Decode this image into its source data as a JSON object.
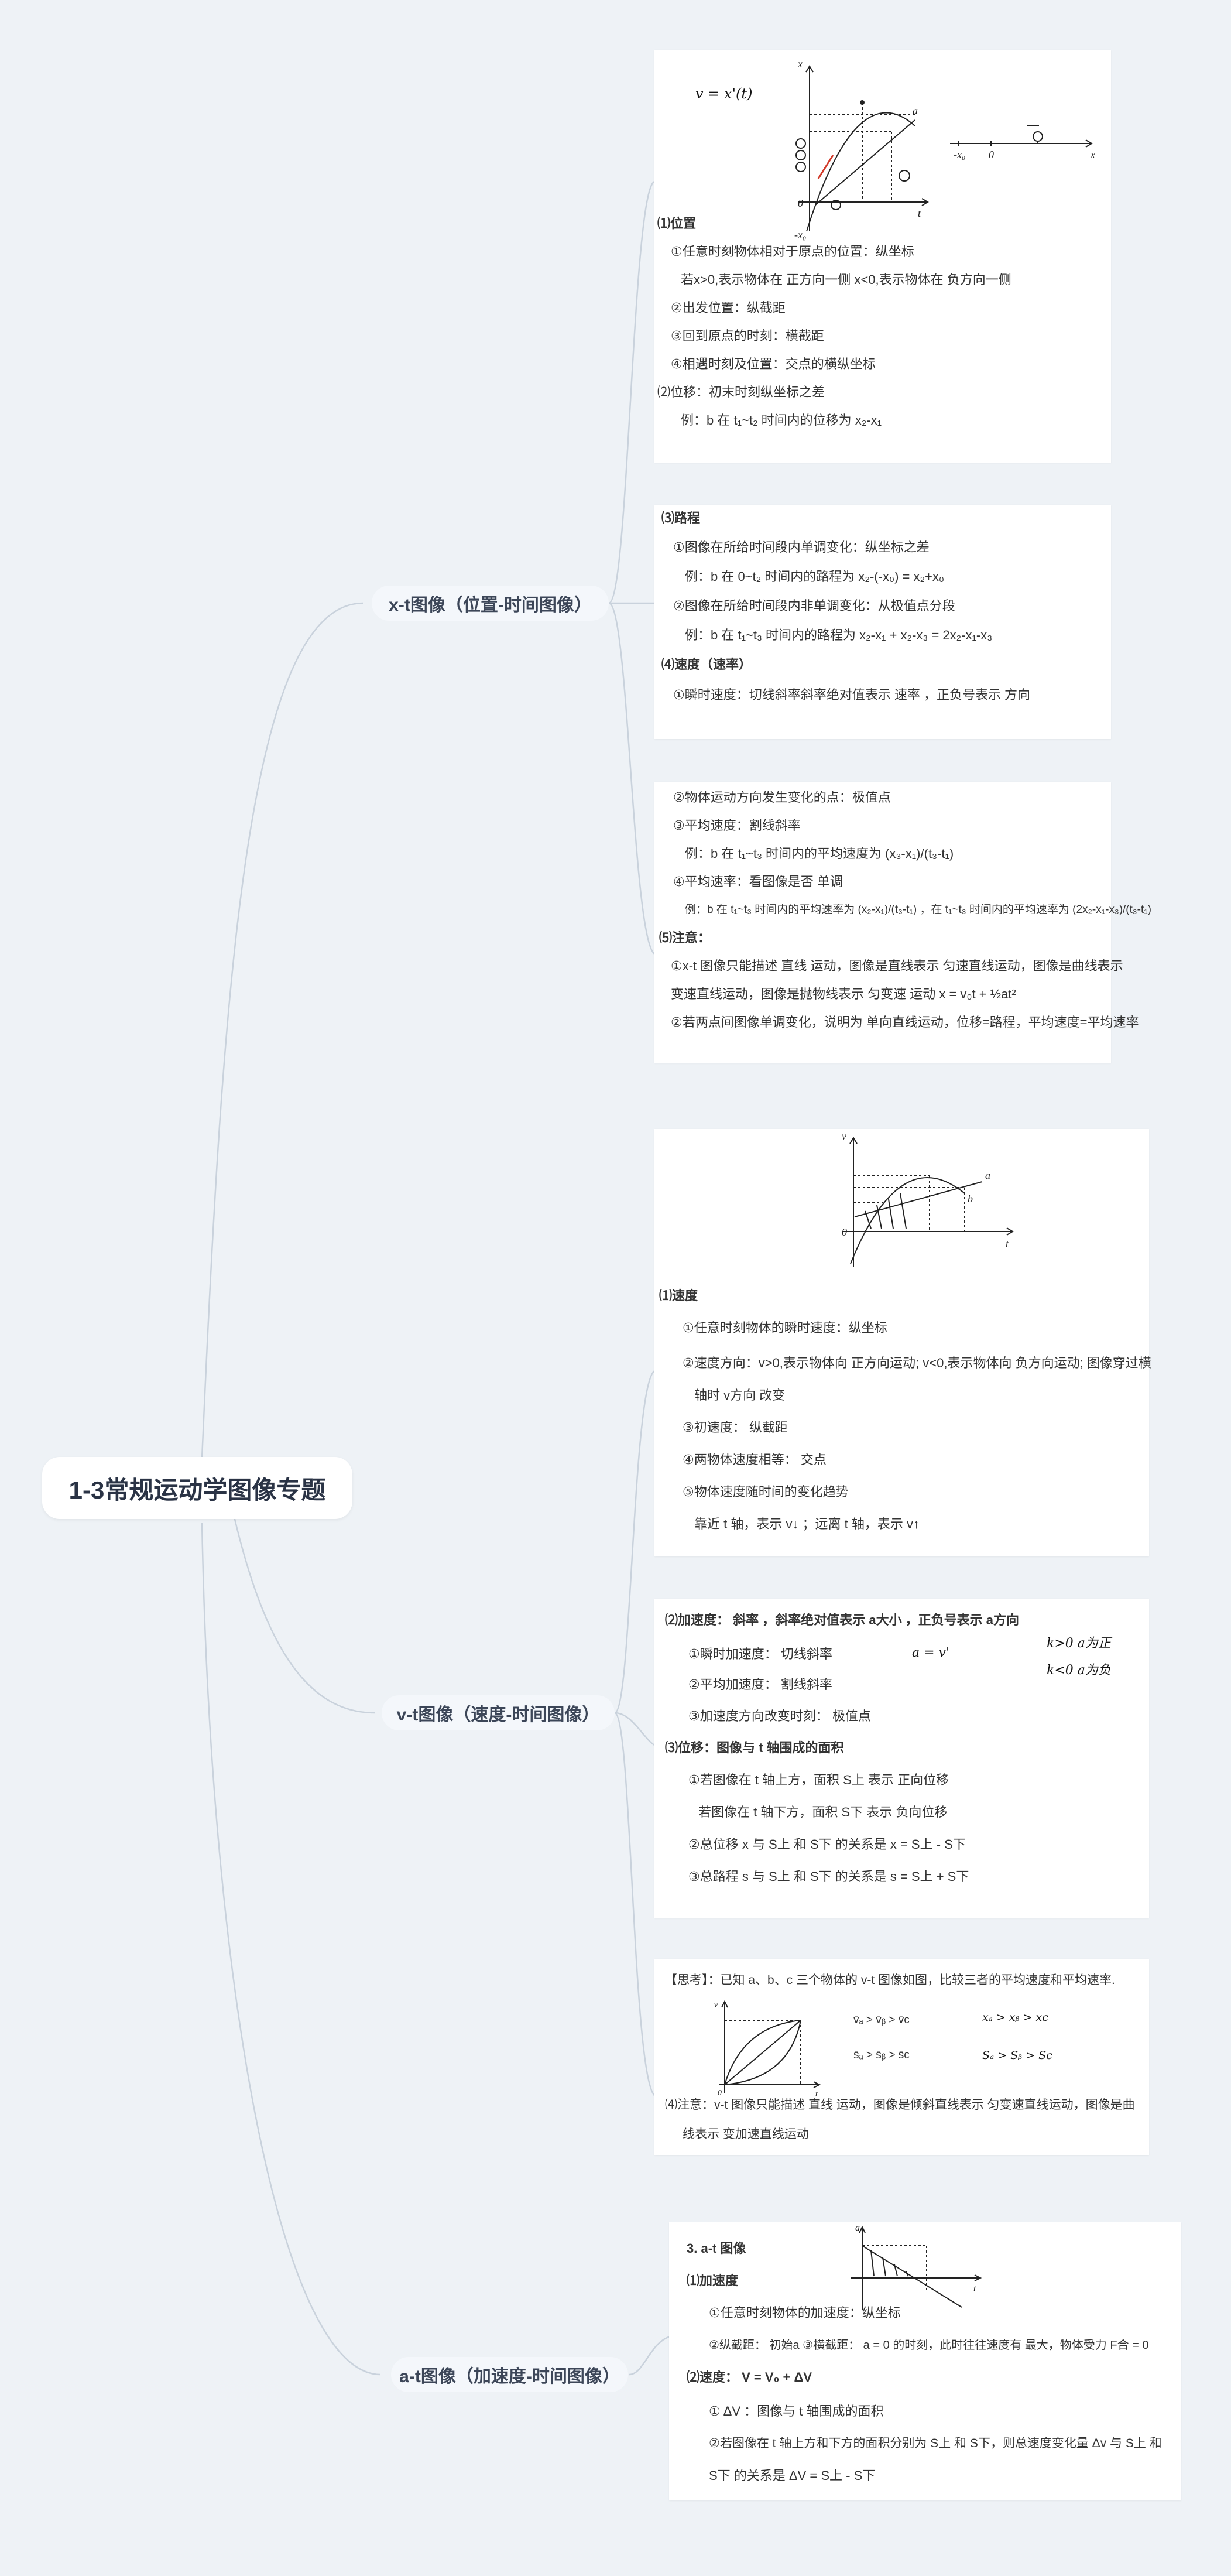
{
  "root": "1-3常规运动学图像专题",
  "branches": {
    "xt": "x-t图像（位置-时间图像）",
    "vt": "v-t图像（速度-时间图像）",
    "at": "a-t图像（加速度-时间图像）"
  },
  "xt1": {
    "fig_v_eq": "v = x'(t)",
    "lines": [
      "⑴位置",
      "①任意时刻物体相对于原点的位置：纵坐标",
      "若x>0,表示物体在 正方向一侧 x<0,表示物体在 负方向一侧",
      "②出发位置：纵截距",
      "③回到原点的时刻：横截距",
      "④相遇时刻及位置：交点的横纵坐标",
      "⑵位移：初末时刻纵坐标之差",
      "例：b 在 t₁~t₂ 时间内的位移为 x₂-x₁"
    ]
  },
  "xt2": {
    "lines": [
      "⑶路程",
      "①图像在所给时间段内单调变化：纵坐标之差",
      "例：b 在 0~t₂ 时间内的路程为 x₂-(-x₀) = x₂+x₀",
      "②图像在所给时间段内非单调变化：从极值点分段",
      "例：b 在 t₁~t₃ 时间内的路程为 x₂-x₁ + x₂-x₃ = 2x₂-x₁-x₃",
      "⑷速度（速率）",
      "①瞬时速度：切线斜率斜率绝对值表示 速率 ，正负号表示 方向"
    ]
  },
  "xt3": {
    "lines": [
      "②物体运动方向发生变化的点：极值点",
      "③平均速度：割线斜率",
      "例：b 在 t₁~t₃ 时间内的平均速度为 (x₃-x₁)/(t₃-t₁)",
      "④平均速率：看图像是否 单调",
      "例：b 在 t₁~t₃ 时间内的平均速率为 (x₂-x₁)/(t₃-t₁) ，在 t₁~t₃ 时间内的平均速率为 (2x₂-x₁-x₃)/(t₃-t₁)",
      "⑸注意：",
      "①x-t 图像只能描述 直线 运动，图像是直线表示 匀速直线运动，图像是曲线表示",
      "变速直线运动，图像是抛物线表示 匀变速 运动    x = v₀t + ½at²",
      "②若两点间图像单调变化，说明为 单向直线运动，位移=路程，平均速度=平均速率"
    ]
  },
  "vt1": {
    "lines": [
      "⑴速度",
      "①任意时刻物体的瞬时速度：纵坐标",
      "②速度方向：v>0,表示物体向 正方向运动; v<0,表示物体向 负方向运动; 图像穿过横",
      "轴时 v方向 改变",
      "③初速度： 纵截距",
      "④两物体速度相等： 交点",
      "⑤物体速度随时间的变化趋势",
      "靠近 t 轴，表示 v↓ ；远离 t 轴，表示 v↑"
    ]
  },
  "vt2": {
    "lines": [
      "⑵加速度： 斜率 ，斜率绝对值表示 a大小 ，正负号表示 a方向",
      "①瞬时加速度： 切线斜率",
      "②平均加速度： 割线斜率",
      "③加速度方向改变时刻： 极值点",
      "⑶位移：图像与 t 轴围成的面积",
      "①若图像在 t 轴上方，面积 S上 表示 正向位移",
      "若图像在 t 轴下方，面积 S下 表示 负向位移",
      "②总位移 x 与 S上 和 S下 的关系是 x = S上 - S下",
      "③总路程 s 与 S上 和 S下 的关系是 s = S上 + S下"
    ],
    "note_a": "a = v'",
    "note_k1": "k>0  a为正",
    "note_k2": "k<0  a为负"
  },
  "vt3": {
    "lines": [
      "【思考】：已知 a、b、c 三个物体的 v-t 图像如图，比较三者的平均速度和平均速率.",
      "⑷注意：v-t 图像只能描述 直线 运动，图像是倾斜直线表示 匀变速直线运动，图像是曲",
      "线表示 变加速直线运动"
    ],
    "compare": [
      "v̄ₐ > v̄ᵦ > v̄c",
      "s̄ₐ > s̄ᵦ > s̄c",
      "xₐ > xᵦ > xc",
      "Sₐ > Sᵦ > Sc"
    ]
  },
  "at1": {
    "lines": [
      "3. a-t 图像",
      "⑴加速度",
      "①任意时刻物体的加速度：纵坐标",
      "②纵截距： 初始a ③横截距： a = 0 的时刻，此时往往速度有 最大，物体受力 F合 = 0",
      "⑵速度： V = V₀ + ΔV",
      "① ΔV ：图像与 t 轴围成的面积",
      "②若图像在 t 轴上方和下方的面积分别为 S上 和 S下，则总速度变化量 Δv 与 S上 和",
      "S下 的关系是 ΔV = S上 - S下"
    ]
  }
}
